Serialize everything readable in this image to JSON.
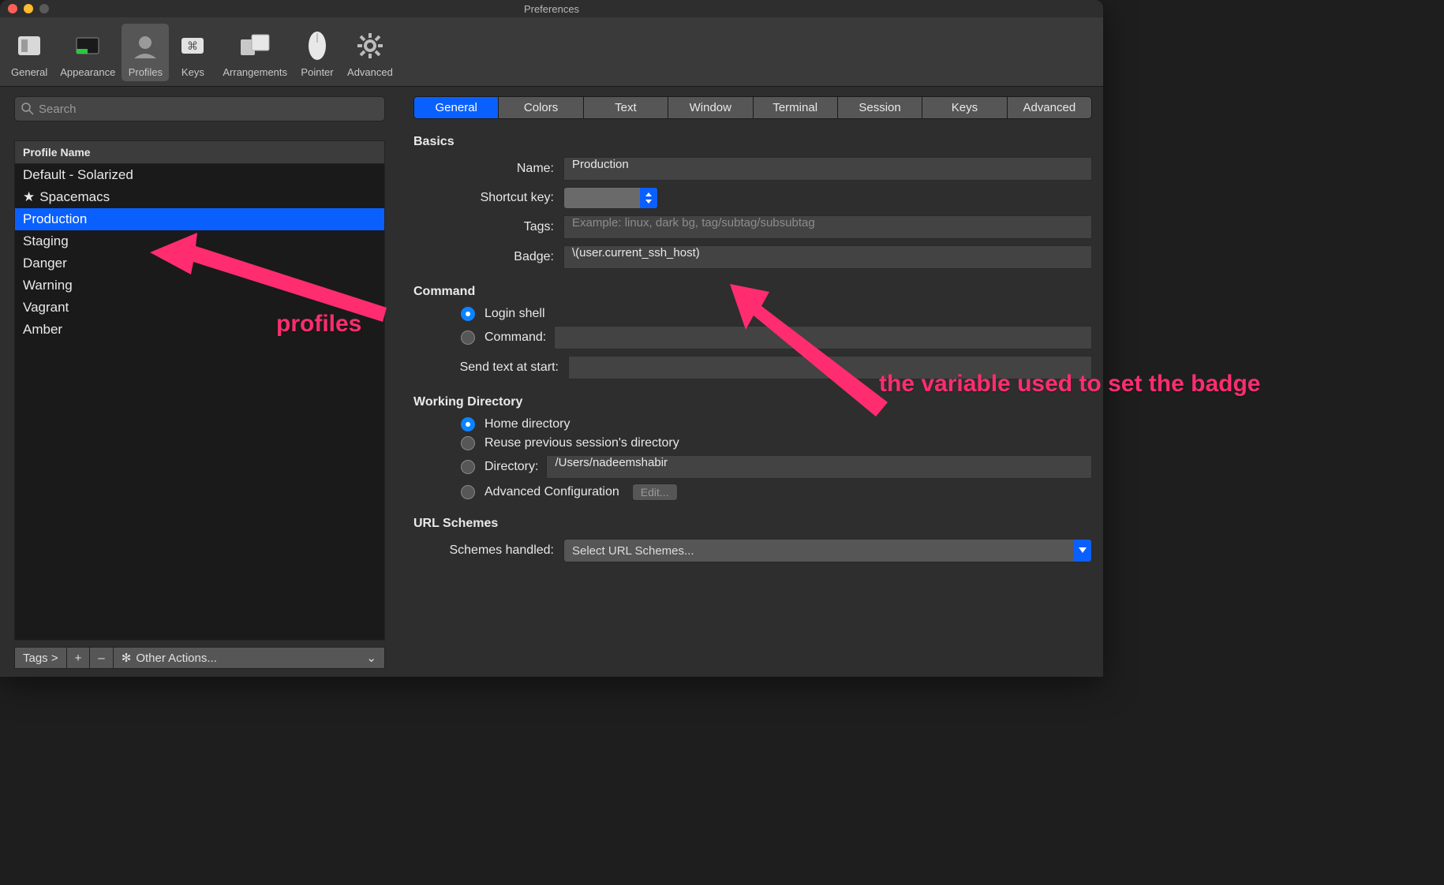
{
  "window": {
    "title": "Preferences"
  },
  "toolbar": {
    "items": [
      {
        "label": "General"
      },
      {
        "label": "Appearance"
      },
      {
        "label": "Profiles"
      },
      {
        "label": "Keys"
      },
      {
        "label": "Arrangements"
      },
      {
        "label": "Pointer"
      },
      {
        "label": "Advanced"
      }
    ],
    "selected": "Profiles"
  },
  "left": {
    "search_placeholder": "Search",
    "header": "Profile Name",
    "profiles": [
      {
        "label": "Default - Solarized",
        "star": false
      },
      {
        "label": "Spacemacs",
        "star": true
      },
      {
        "label": "Production",
        "star": false,
        "selected": true
      },
      {
        "label": "Staging",
        "star": false
      },
      {
        "label": "Danger",
        "star": false
      },
      {
        "label": "Warning",
        "star": false
      },
      {
        "label": "Vagrant",
        "star": false
      },
      {
        "label": "Amber",
        "star": false
      }
    ],
    "buttons": {
      "tags": "Tags >",
      "plus": "+",
      "minus": "–",
      "other": "Other Actions..."
    }
  },
  "tabs": {
    "items": [
      "General",
      "Colors",
      "Text",
      "Window",
      "Terminal",
      "Session",
      "Keys",
      "Advanced"
    ],
    "selected": "General"
  },
  "sections": {
    "basics": {
      "title": "Basics",
      "name_label": "Name:",
      "name_value": "Production",
      "shortcut_label": "Shortcut key:",
      "tags_label": "Tags:",
      "tags_placeholder": "Example: linux, dark bg, tag/subtag/subsubtag",
      "badge_label": "Badge:",
      "badge_value": "\\(user.current_ssh_host)"
    },
    "command": {
      "title": "Command",
      "login_shell": "Login shell",
      "command": "Command:",
      "send_text_label": "Send text at start:"
    },
    "working_dir": {
      "title": "Working Directory",
      "home": "Home directory",
      "reuse": "Reuse previous session's directory",
      "directory": "Directory:",
      "directory_value": "/Users/nadeemshabir",
      "advanced": "Advanced Configuration",
      "edit": "Edit..."
    },
    "url": {
      "title": "URL Schemes",
      "label": "Schemes handled:",
      "select": "Select URL Schemes..."
    }
  },
  "annotations": {
    "profiles": "profiles",
    "badge": "the variable used to set the badge"
  }
}
